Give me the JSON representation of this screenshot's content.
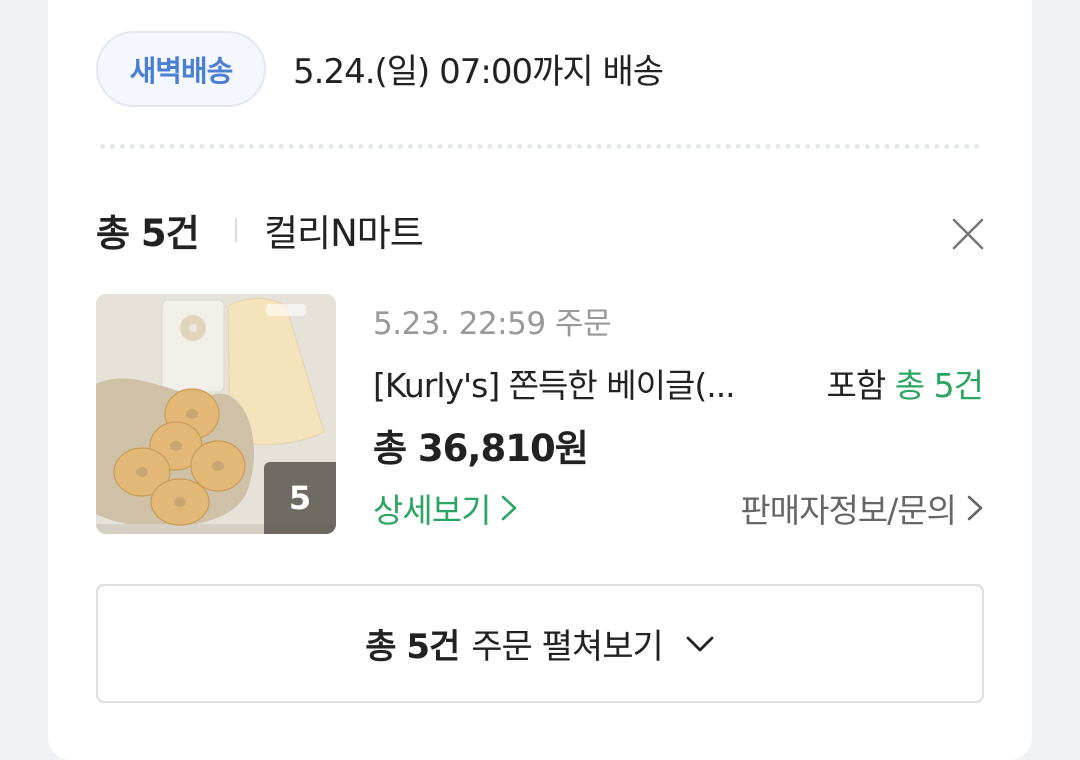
{
  "delivery": {
    "badge": "새벽배송",
    "text": "5.24.(일) 07:00까지 배송"
  },
  "order_group": {
    "total_count": "총 5건",
    "store_name": "컬리N마트"
  },
  "order": {
    "order_time": "5.23. 22:59 주문",
    "product_name": "[Kurly's] 쫀득한 베이글(...",
    "includes_label": "포함",
    "includes_count": "총 5건",
    "total_price": "총 36,810원",
    "thumbnail_count": "5",
    "detail_link": "상세보기",
    "seller_link": "판매자정보/문의"
  },
  "expand": {
    "count": "총 5건",
    "label": "주문 펼쳐보기"
  },
  "colors": {
    "accent_green": "#2aa562",
    "badge_blue": "#4a7fd4"
  },
  "icons": {
    "close": "close-icon",
    "chevron_right": "chevron-right-icon",
    "chevron_down": "chevron-down-icon"
  }
}
